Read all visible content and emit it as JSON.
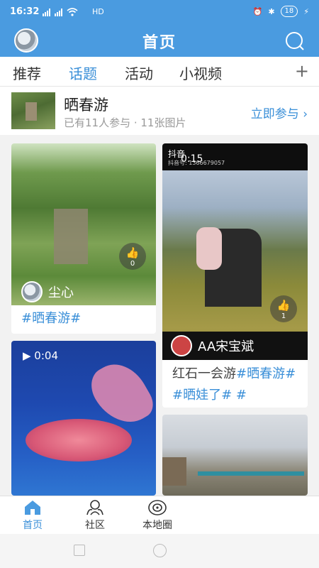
{
  "status_bar": {
    "time": "16:32",
    "network": "HD",
    "battery": "18"
  },
  "header": {
    "title": "首页",
    "search_icon": "search-icon",
    "accent_color": "#4a9be0"
  },
  "tabs": [
    {
      "label": "推荐",
      "active": false
    },
    {
      "label": "话题",
      "active": true
    },
    {
      "label": "活动",
      "active": false
    },
    {
      "label": "小视频",
      "active": false
    }
  ],
  "tab_add": "+",
  "topic": {
    "name": "晒春游",
    "meta": "已有11人参与 · 11张图片",
    "join_label": "立即参与 ›"
  },
  "feed": [
    {
      "author": "尘心",
      "likes": "0",
      "caption": "#晒春游#"
    },
    {
      "watermark": "抖音",
      "duration_overlay": "0:15",
      "douyin_id": "抖音号: 1366679057",
      "author": "AA宋宝斌",
      "likes": "1",
      "caption_text": "红石一会游",
      "caption_tags": "#晒春游# #晒娃了# #"
    },
    {
      "duration": "▶ 0:04"
    },
    {}
  ],
  "bottom_nav": [
    {
      "label": "首页",
      "icon": "home-icon",
      "active": true
    },
    {
      "label": "社区",
      "icon": "community-icon",
      "active": false
    },
    {
      "label": "本地圈",
      "icon": "local-circle-icon",
      "active": false
    }
  ]
}
